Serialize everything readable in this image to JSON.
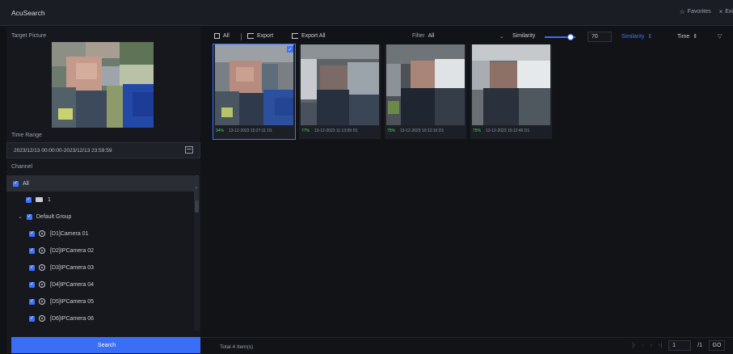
{
  "app": {
    "title": "AcuSearch"
  },
  "top_actions": {
    "favorites": "Favorites",
    "exit": "Exi"
  },
  "left_panel": {
    "target_picture_label": "Target Picture",
    "time_range_label": "Time Range",
    "time_range_value": "2023/12/13 00:00:00-2023/12/13 23:59:59",
    "channel_label": "Channel",
    "tree": [
      {
        "label": "All",
        "level": 0,
        "selected": true
      },
      {
        "label": "1",
        "level": 1,
        "icon": "folder-icon"
      },
      {
        "label": "Default Group",
        "level": 1,
        "expandable": true
      },
      {
        "label": "[D1]Camera 01",
        "level": 2,
        "icon": "camera-icon"
      },
      {
        "label": "[D2]IPCamera 02",
        "level": 2,
        "icon": "camera-icon"
      },
      {
        "label": "[D3]IPCamera 03",
        "level": 2,
        "icon": "camera-icon"
      },
      {
        "label": "[D4]IPCamera 04",
        "level": 2,
        "icon": "camera-icon"
      },
      {
        "label": "[D5]IPCamera 05",
        "level": 2,
        "icon": "camera-icon"
      },
      {
        "label": "[D6]IPCamera 06",
        "level": 2,
        "icon": "camera-icon"
      }
    ],
    "search_button": "Search"
  },
  "toolbar": {
    "all_label": "All",
    "export_label": "Export",
    "export_all_label": "Export All",
    "filter_label": "Filter",
    "filter_value": "All",
    "similarity_label": "Similarity",
    "similarity_value": "70",
    "sort_similarity": "Similarity",
    "sort_time": "Time"
  },
  "results": [
    {
      "similarity": "94%",
      "timestamp": "13-12-2023 15:27:11 D1",
      "selected": true
    },
    {
      "similarity": "77%",
      "timestamp": "13-12-2023 11:13:09 D1",
      "selected": false
    },
    {
      "similarity": "75%",
      "timestamp": "13-12-2023 10:12:16 D1",
      "selected": false
    },
    {
      "similarity": "75%",
      "timestamp": "13-12-2023 15:12:46 D1",
      "selected": false
    }
  ],
  "footer": {
    "total": "Total 4 Item(s)",
    "page_current": "1",
    "page_total": "/1",
    "go_label": "GO"
  },
  "colors": {
    "accent": "#3b6ef6",
    "similarity_green": "#4cd964",
    "background": "#101216"
  }
}
